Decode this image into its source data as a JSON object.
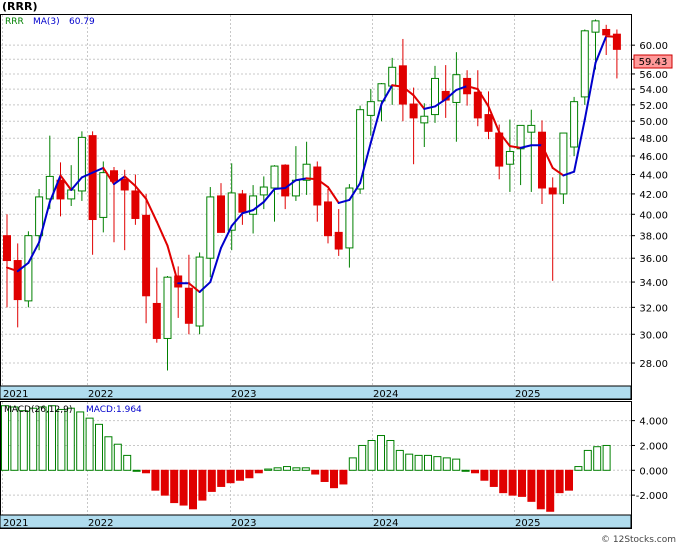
{
  "header": {
    "ticker": "(RRR)",
    "ma_label": "RRR",
    "ma_name": "MA(3)",
    "ma_value": "60.79",
    "macd_name": "MACD(26,12,9)",
    "macd_label": "MACD:1.964",
    "watermark": "© 12Stocks.com"
  },
  "colors": {
    "up": "#008000",
    "down": "#e00000",
    "ma_up": "#0000cc",
    "ma_down": "#e00000",
    "axis_band": "#b0dcee",
    "last_price_box": "#ff9999",
    "grid": "#c8c8c8"
  },
  "chart_data": [
    {
      "type": "candlestick",
      "title": "(RRR)",
      "ylim": [
        26.5,
        64.5
      ],
      "y_scale": "log",
      "y_ticks": [
        "28.00",
        "30.00",
        "32.00",
        "34.00",
        "36.00",
        "38.00",
        "40.00",
        "42.00",
        "44.00",
        "46.00",
        "48.00",
        "50.00",
        "52.00",
        "54.00",
        "56.00",
        "58.00",
        "60.00"
      ],
      "x_tick_labels": [
        "2021",
        "2022",
        "2023",
        "2024",
        "2025"
      ],
      "x_tick_bars": [
        0,
        10,
        20,
        30,
        40
      ],
      "last_price": "59.43",
      "grid": true,
      "series": [
        {
          "name": "RRR",
          "ohlc": [
            [
              38.0,
              40.0,
              32.0,
              35.8
            ],
            [
              35.8,
              37.3,
              30.5,
              32.6
            ],
            [
              32.5,
              38.4,
              32.0,
              38.0
            ],
            [
              38.0,
              42.5,
              36.7,
              41.7
            ],
            [
              41.5,
              48.3,
              40.5,
              43.8
            ],
            [
              43.4,
              45.3,
              39.8,
              41.5
            ],
            [
              41.5,
              45.0,
              40.8,
              42.4
            ],
            [
              42.3,
              48.8,
              41.3,
              48.1
            ],
            [
              48.3,
              48.8,
              36.3,
              39.5
            ],
            [
              39.7,
              45.4,
              38.3,
              44.2
            ],
            [
              44.4,
              44.8,
              37.4,
              43.3
            ],
            [
              43.5,
              44.5,
              36.7,
              42.4
            ],
            [
              42.3,
              44.0,
              39.0,
              39.6
            ],
            [
              39.9,
              42.0,
              30.8,
              32.9
            ],
            [
              32.3,
              35.2,
              29.4,
              29.7
            ],
            [
              29.7,
              34.5,
              27.5,
              34.4
            ],
            [
              34.5,
              35.3,
              31.2,
              33.6
            ],
            [
              33.5,
              36.3,
              30.0,
              30.8
            ],
            [
              30.6,
              36.5,
              30.0,
              36.1
            ],
            [
              36.0,
              42.7,
              34.4,
              41.7
            ],
            [
              41.8,
              43.1,
              39.0,
              38.3
            ],
            [
              38.5,
              45.2,
              36.7,
              42.1
            ],
            [
              42.0,
              42.4,
              39.0,
              40.2
            ],
            [
              40.0,
              42.9,
              38.2,
              41.8
            ],
            [
              41.9,
              43.8,
              40.5,
              42.7
            ],
            [
              42.6,
              45.0,
              39.3,
              44.9
            ],
            [
              45.0,
              45.1,
              40.5,
              41.8
            ],
            [
              41.8,
              47.1,
              41.3,
              43.4
            ],
            [
              43.4,
              47.6,
              41.9,
              45.1
            ],
            [
              44.8,
              45.4,
              39.3,
              40.9
            ],
            [
              41.2,
              42.5,
              37.3,
              38.0
            ],
            [
              38.3,
              40.5,
              36.2,
              36.8
            ],
            [
              36.9,
              43.0,
              35.2,
              42.6
            ],
            [
              42.5,
              51.9,
              42.0,
              51.4
            ],
            [
              50.7,
              54.0,
              48.3,
              52.4
            ],
            [
              52.5,
              54.8,
              50.0,
              54.7
            ],
            [
              54.4,
              58.2,
              52.0,
              56.9
            ],
            [
              57.1,
              60.9,
              50.0,
              52.1
            ],
            [
              52.1,
              54.2,
              45.1,
              50.4
            ],
            [
              49.8,
              52.2,
              47.0,
              50.6
            ],
            [
              50.8,
              57.1,
              49.8,
              55.4
            ],
            [
              53.7,
              57.2,
              50.4,
              52.6
            ],
            [
              52.3,
              59.0,
              47.6,
              55.9
            ],
            [
              55.4,
              56.5,
              51.9,
              53.4
            ],
            [
              53.6,
              56.5,
              49.4,
              50.4
            ],
            [
              50.8,
              53.7,
              47.9,
              48.8
            ],
            [
              48.6,
              49.6,
              43.5,
              44.9
            ],
            [
              45.1,
              50.2,
              42.2,
              46.5
            ],
            [
              46.8,
              49.0,
              42.9,
              49.5
            ],
            [
              48.7,
              51.4,
              42.2,
              49.5
            ],
            [
              48.7,
              50.1,
              41.0,
              42.6
            ],
            [
              42.6,
              43.7,
              34.1,
              42.0
            ],
            [
              42.0,
              46.5,
              41.0,
              48.6
            ],
            [
              47.0,
              53.0,
              46.0,
              52.4
            ],
            [
              53.0,
              62.3,
              52.0,
              62.1
            ],
            [
              61.9,
              63.8,
              56.6,
              63.6
            ],
            [
              62.3,
              63.0,
              58.6,
              61.5
            ],
            [
              61.6,
              62.3,
              55.4,
              59.4
            ]
          ]
        },
        {
          "name": "MA(3)",
          "values": [
            35.2,
            34.9,
            35.6,
            37.4,
            41.2,
            43.9,
            42.4,
            43.7,
            44.2,
            44.7,
            43.0,
            43.8,
            42.8,
            41.5,
            39.3,
            37.1,
            33.9,
            33.9,
            33.2,
            34.0,
            36.9,
            38.9,
            40.1,
            40.4,
            41.2,
            42.5,
            42.6,
            43.4,
            43.6,
            43.5,
            42.7,
            41.1,
            41.4,
            43.1,
            47.5,
            52.1,
            54.5,
            54.3,
            53.2,
            51.5,
            51.8,
            52.7,
            53.9,
            54.4,
            54.0,
            51.8,
            48.7,
            47.1,
            46.9,
            47.2,
            47.2,
            44.7,
            43.9,
            44.3,
            50.2,
            57.5,
            61.3,
            61.2
          ]
        }
      ]
    },
    {
      "type": "bar",
      "title": "MACD(26,12,9)",
      "ylim": [
        -3.6,
        5.5
      ],
      "y_ticks": [
        "-2.000",
        "0.000",
        "2.000",
        "4.000"
      ],
      "x_tick_labels": [
        "2021",
        "2022",
        "2023",
        "2024",
        "2025"
      ],
      "series": [
        {
          "name": "MACD",
          "values": [
            5.2,
            5.1,
            4.8,
            5.0,
            5.1,
            5.2,
            4.9,
            5.0,
            4.7,
            4.2,
            3.7,
            2.7,
            2.1,
            1.2,
            0.0,
            -0.2,
            -1.6,
            -2.0,
            -2.6,
            -2.8,
            -3.1,
            -2.4,
            -1.7,
            -1.3,
            -1.0,
            -0.8,
            -0.6,
            -0.2,
            0.1,
            0.2,
            0.3,
            0.2,
            0.2,
            -0.3,
            -0.9,
            -1.4,
            -1.1,
            1.0,
            2.0,
            2.4,
            2.8,
            2.4,
            1.6,
            1.3,
            1.2,
            1.2,
            1.1,
            1.0,
            0.9,
            0.0,
            -0.2,
            -0.8,
            -1.3,
            -1.8,
            -2.0,
            -2.1,
            -2.5,
            -3.1,
            -3.3,
            -1.8,
            -1.6,
            0.3,
            1.6,
            1.9,
            2.0
          ]
        }
      ]
    }
  ]
}
